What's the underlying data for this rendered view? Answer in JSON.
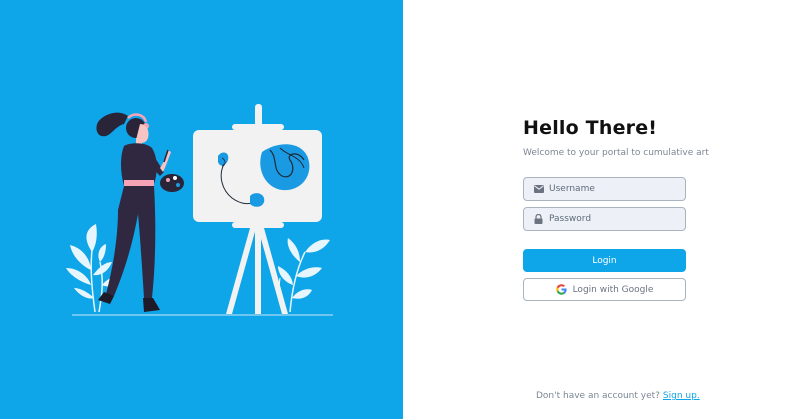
{
  "brand": {
    "accent": "#0ea5e9"
  },
  "illustration": {
    "name": "artist-painting-illustration"
  },
  "login": {
    "title": "Hello There!",
    "subtitle": "Welcome to your portal to cumulative art",
    "username_placeholder": "Username",
    "username_icon": "envelope-icon",
    "password_placeholder": "Password",
    "password_icon": "lock-icon",
    "login_button": "Login",
    "google_button": "Login with Google",
    "google_icon": "google-icon"
  },
  "footer": {
    "text": "Don't have an account yet?",
    "link": "Sign up."
  }
}
